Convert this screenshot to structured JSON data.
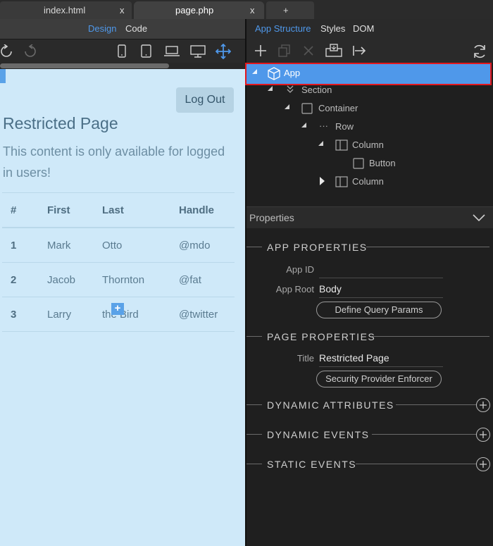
{
  "tabs": [
    {
      "label": "index.html",
      "close": "x"
    },
    {
      "label": "page.php",
      "close": "x"
    },
    {
      "label": "+"
    }
  ],
  "left_toolbar": {
    "design": "Design",
    "code": "Code"
  },
  "right_toolbar": {
    "tabs": [
      "App Structure",
      "Styles",
      "DOM"
    ]
  },
  "canvas": {
    "logout_label": "Log Out",
    "title": "Restricted Page",
    "lead": "This content is only available for logged in users!",
    "table": {
      "headers": [
        "#",
        "First",
        "Last",
        "Handle"
      ],
      "rows": [
        [
          "1",
          "Mark",
          "Otto",
          "@mdo"
        ],
        [
          "2",
          "Jacob",
          "Thornton",
          "@fat"
        ],
        [
          "3",
          "Larry",
          "the Bird",
          "@twitter"
        ]
      ]
    }
  },
  "tree": {
    "nodes": [
      {
        "label": "App",
        "icon": "cube-icon",
        "selected": true
      },
      {
        "label": "Section",
        "icon": "double-chevron-icon"
      },
      {
        "label": "Container",
        "icon": "square-icon"
      },
      {
        "label": "Row",
        "icon": "dots-icon"
      },
      {
        "label": "Column",
        "icon": "column-icon"
      },
      {
        "label": "Button",
        "icon": "square-icon"
      },
      {
        "label": "Column",
        "icon": "column-icon"
      }
    ]
  },
  "properties": {
    "header": "Properties",
    "app_section": "APP PROPERTIES",
    "app_id_label": "App ID",
    "app_id_value": "",
    "app_root_label": "App Root",
    "app_root_value": "Body",
    "query_params_button": "Define Query Params",
    "page_section": "PAGE PROPERTIES",
    "title_label": "Title",
    "title_value": "Restricted Page",
    "security_button": "Security Provider Enforcer",
    "dynamic_attributes": "DYNAMIC ATTRIBUTES",
    "dynamic_events": "DYNAMIC EVENTS",
    "static_events": "STATIC EVENTS"
  },
  "colors": {
    "accent": "#4f98ea",
    "highlight_border": "#e3171d",
    "canvas_bg": "#cfe9f9"
  }
}
